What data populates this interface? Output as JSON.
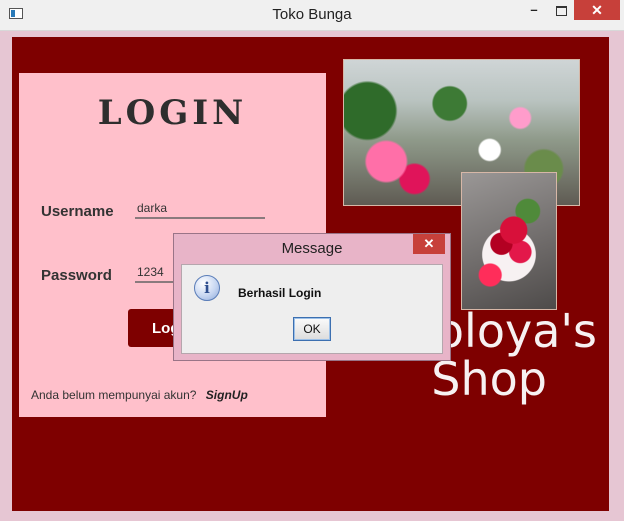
{
  "window": {
    "title": "Toko Bunga",
    "min_label": "–",
    "close_label": "✕"
  },
  "login": {
    "heading": "LOGIN",
    "username_label": "Username",
    "username_value": "darka",
    "password_label": "Password",
    "password_value": "1234",
    "login_button": "Login",
    "signup_prompt": "Anda belum mempunyai akun?",
    "signup_link": "SignUp"
  },
  "brand": {
    "line1": "Noloya's",
    "line2": "Shop"
  },
  "dialog": {
    "title": "Message",
    "close_label": "✕",
    "icon_glyph": "i",
    "message": "Berhasil Login",
    "ok_label": "OK"
  },
  "colors": {
    "background": "#7e0000",
    "panel": "#ffc0cb",
    "close_button": "#c7403a"
  }
}
